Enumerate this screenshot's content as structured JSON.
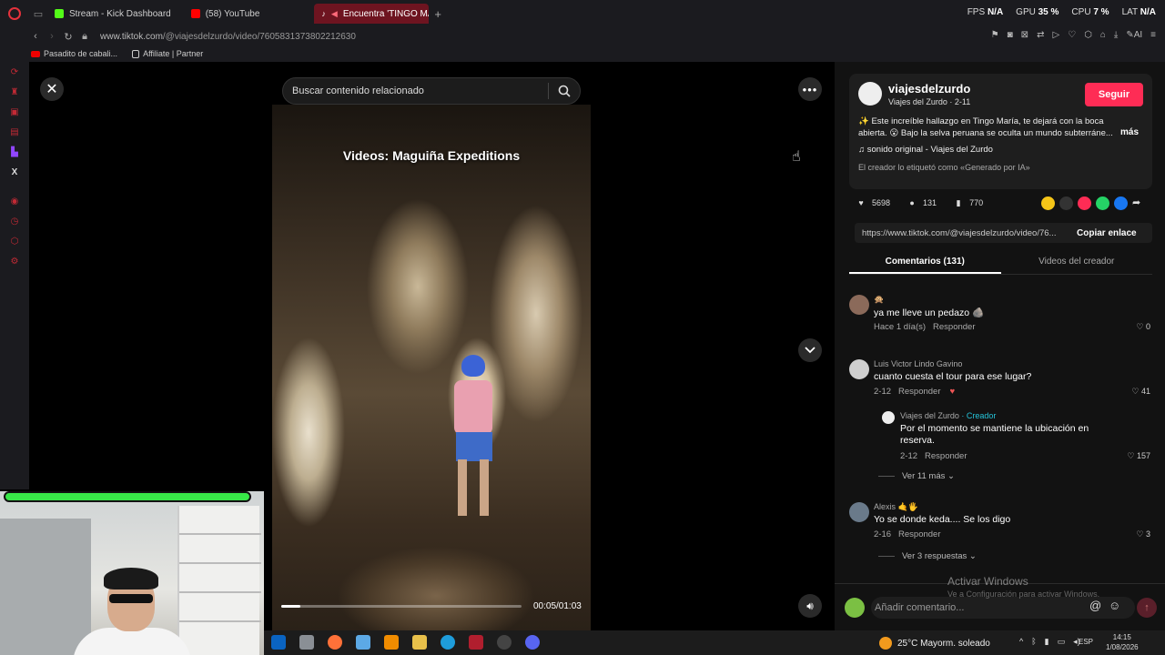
{
  "browser": {
    "tabs": [
      {
        "label": "Stream - Kick Dashboard",
        "favicon_color": "#53fc18"
      },
      {
        "label": "(58) YouTube",
        "favicon_color": "#ff0000"
      },
      {
        "label": "Encuentra 'TINGO MAR",
        "favicon_color": "#ffffff",
        "active": true
      }
    ],
    "stats": [
      {
        "label": "FPS",
        "value": "N/A"
      },
      {
        "label": "GPU",
        "value": "35 %"
      },
      {
        "label": "CPU",
        "value": "7 %"
      },
      {
        "label": "LAT",
        "value": "N/A"
      }
    ],
    "url_domain": "www.tiktok.com",
    "url_path": "/@viajesdelzurdo/video/7605831373802212630",
    "bookmarks": [
      {
        "label": "Pasadito de cabali..."
      },
      {
        "label": "Affiliate | Partner"
      }
    ]
  },
  "viewer": {
    "search_placeholder": "Buscar contenido relacionado",
    "video_caption": "Videos: Maguiña Expeditions",
    "time": "00:05/01:03",
    "progress": 0.08
  },
  "post": {
    "author_name": "viajesdelzurdo",
    "author_sub": "Viajes del Zurdo · 2-11",
    "follow_label": "Seguir",
    "description": "✨ Este increíble hallazgo en Tingo María, te dejará con la boca abierta. 😮 Bajo la selva peruana se oculta un mundo subterráne...",
    "more_label": "más",
    "sound": "♫  sonido original - Viajes del Zurdo",
    "ai_label": "El creador lo etiquetó como «Generado por IA»",
    "likes": "5698",
    "comments_count": "131",
    "saves": "770",
    "share_link": "https://www.tiktok.com/@viajesdelzurdo/video/76...",
    "copy_label": "Copiar enlace"
  },
  "panel_tabs": {
    "comments": "Comentarios (131)",
    "creator_videos": "Videos del creador"
  },
  "comments": [
    {
      "user": "🙊",
      "text": "ya me lleve un pedazo 🪨",
      "date": "Hace 1 día(s)",
      "reply": "Responder",
      "likes": "0"
    },
    {
      "user": "Luis Victor Lindo Gavino",
      "text": "cuanto cuesta el tour para ese lugar?",
      "date": "2-12",
      "reply": "Responder",
      "likes": "41"
    },
    {
      "user": "Alexis 🤙🖐",
      "text": "Yo se donde keda.... Se los digo",
      "date": "2-16",
      "reply": "Responder",
      "likes": "3"
    }
  ],
  "creator_reply": {
    "user": "Viajes del Zurdo",
    "tag": " · Creador",
    "text_line1": "Por el momento se mantiene la ubicación en",
    "text_line2": "reserva.",
    "date": "2-12",
    "reply": "Responder",
    "likes": "157"
  },
  "view_more_1": "Ver 11 más",
  "view_more_2": "Ver 3 respuestas",
  "comment_input_placeholder": "Añadir comentario...",
  "watermark": {
    "title": "Activar Windows",
    "subtitle": "Ve a Configuración para activar Windows."
  },
  "taskbar": {
    "weather": "25°C  Mayorm. soleado",
    "lang": "ESP",
    "time": "14:15",
    "date": "1/08/2026"
  },
  "colors": {
    "accent": "#fe2c55",
    "creator": "#25c3d8",
    "webcam_bar": "#38e848"
  }
}
